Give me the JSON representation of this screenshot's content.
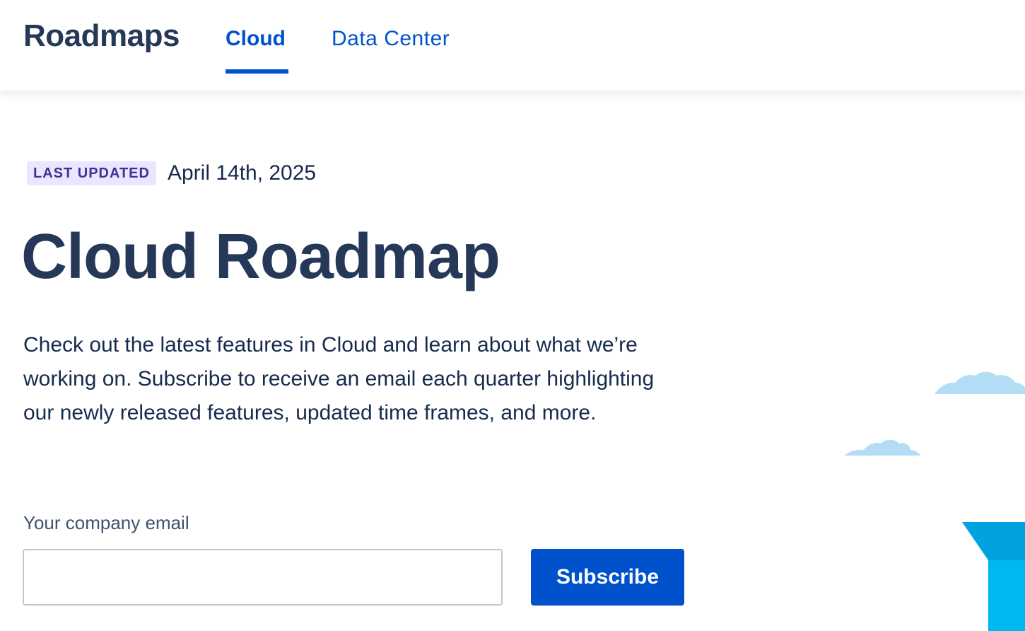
{
  "header": {
    "brand": "Roadmaps",
    "tabs": [
      {
        "label": "Cloud",
        "active": true
      },
      {
        "label": "Data Center",
        "active": false
      }
    ]
  },
  "main": {
    "badge": "LAST UPDATED",
    "updated_date": "April 14th, 2025",
    "title": "Cloud Roadmap",
    "intro": "Check out the latest features in Cloud and learn about what we’re working on. Subscribe to receive an email each quarter highlighting our newly released features, updated time frames, and more.",
    "form": {
      "email_label": "Your company email",
      "email_value": "",
      "email_placeholder": "",
      "subscribe_label": "Subscribe"
    }
  },
  "colors": {
    "brand_text": "#253858",
    "link_blue": "#0052cc",
    "badge_bg": "#eae6ff",
    "badge_text": "#403294",
    "cloud": "#b3dcf5",
    "shape_cyan": "#00b8f0"
  },
  "icons": {
    "decorative": [
      "cloud-shape",
      "cloud-shape",
      "cyan-block-shape"
    ]
  }
}
